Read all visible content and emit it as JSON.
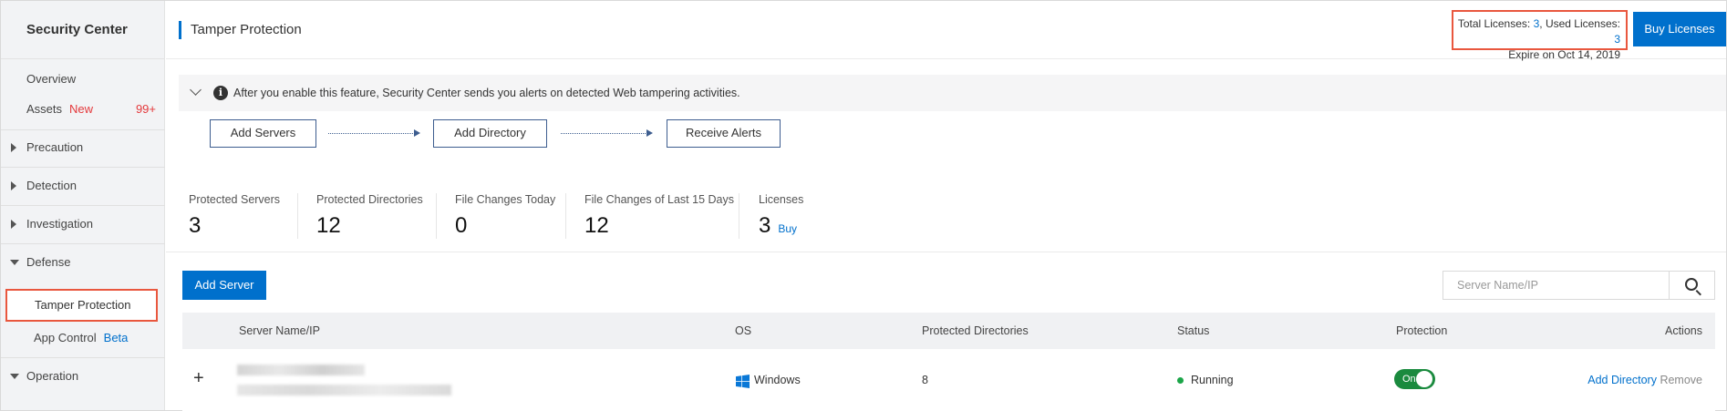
{
  "sidebar": {
    "title": "Security Center",
    "items": [
      {
        "label": "Overview"
      },
      {
        "label": "Assets",
        "badge": "New",
        "count": "99+"
      },
      {
        "label": "Precaution"
      },
      {
        "label": "Detection"
      },
      {
        "label": "Investigation"
      },
      {
        "label": "Defense"
      },
      {
        "label": "Tamper Protection"
      },
      {
        "label": "App Control",
        "badge": "Beta"
      },
      {
        "label": "Operation"
      }
    ]
  },
  "header": {
    "title": "Tamper Protection",
    "total_licenses_label": "Total Licenses:",
    "total_licenses": "3",
    "used_licenses_label": ", Used Licenses:",
    "used_licenses": "3",
    "expire": "Expire on Oct 14, 2019",
    "buy_button": "Buy Licenses"
  },
  "info": {
    "text": "After you enable this feature, Security Center sends you alerts on detected Web tampering activities."
  },
  "steps": [
    "Add Servers",
    "Add Directory",
    "Receive Alerts"
  ],
  "stats": [
    {
      "label": "Protected Servers",
      "value": "3"
    },
    {
      "label": "Protected Directories",
      "value": "12"
    },
    {
      "label": "File Changes Today",
      "value": "0"
    },
    {
      "label": "File Changes of Last 15 Days",
      "value": "12"
    },
    {
      "label": "Licenses",
      "value": "3",
      "link": "Buy"
    }
  ],
  "toolbar": {
    "add_server": "Add Server",
    "search_placeholder": "Server Name/IP"
  },
  "table": {
    "headers": [
      "Server Name/IP",
      "OS",
      "Protected Directories",
      "Status",
      "Protection",
      "Actions"
    ],
    "rows": [
      {
        "os": "Windows",
        "protected_directories": "8",
        "status": "Running",
        "protection": "On",
        "action_add": "Add Directory",
        "action_remove": "Remove"
      }
    ]
  },
  "colors": {
    "accent": "#0070cc",
    "highlight_border": "#e9573e",
    "status_running": "#1ba548",
    "toggle_on": "#1a8a3e",
    "badge_red": "#e4393c"
  }
}
